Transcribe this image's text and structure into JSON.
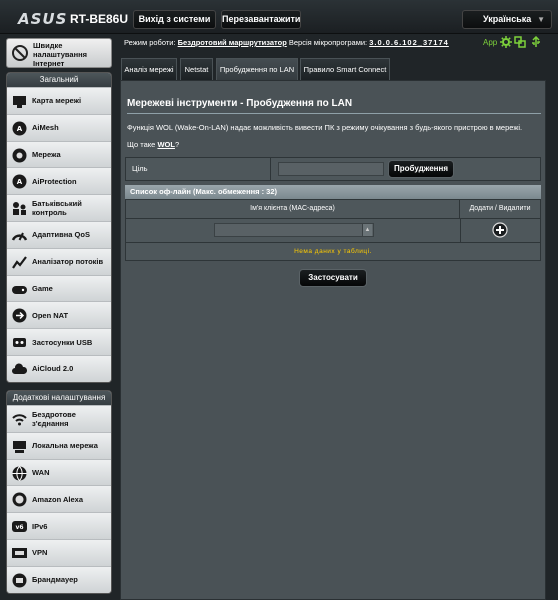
{
  "header": {
    "brand": "ASUS",
    "model": "RT-BE86U",
    "logout_label": "Вихід з системи",
    "reboot_label": "Перезавантажити",
    "language": "Українська"
  },
  "sidebar": {
    "internet_setup": "Швидке налаштування Інтернет",
    "general_title": "Загальний",
    "general_items": [
      {
        "label": "Карта мережі",
        "icon": "network-map-icon"
      },
      {
        "label": "AiMesh",
        "icon": "aimesh-icon"
      },
      {
        "label": "Мережа",
        "icon": "network-icon"
      },
      {
        "label": "AiProtection",
        "icon": "aiprotection-icon"
      },
      {
        "label": "Батьківський контроль",
        "icon": "parental-control-icon"
      },
      {
        "label": "Адаптивна QoS",
        "icon": "qos-icon"
      },
      {
        "label": "Аналізатор потоків",
        "icon": "traffic-analyzer-icon"
      },
      {
        "label": "Game",
        "icon": "game-icon"
      },
      {
        "label": "Open NAT",
        "icon": "open-nat-icon"
      },
      {
        "label": "Застосунки USB",
        "icon": "usb-icon"
      },
      {
        "label": "AiCloud 2.0",
        "icon": "aicloud-icon"
      }
    ],
    "advanced_title": "Додаткові налаштування",
    "advanced_items": [
      {
        "label": "Бездротове з'єднання",
        "icon": "wireless-icon"
      },
      {
        "label": "Локальна мережа",
        "icon": "lan-icon"
      },
      {
        "label": "WAN",
        "icon": "wan-icon"
      },
      {
        "label": "Amazon Alexa",
        "icon": "alexa-icon"
      },
      {
        "label": "IPv6",
        "icon": "ipv6-icon"
      },
      {
        "label": "VPN",
        "icon": "vpn-icon"
      },
      {
        "label": "Брандмауер",
        "icon": "firewall-icon"
      }
    ]
  },
  "status": {
    "mode_prefix": "Режим роботи:",
    "mode_value": "Бездротовий маршрутизатор",
    "fw_prefix": "Версія мікропрограми:",
    "fw_value": "3.0.0.6.102_37174",
    "app_label": "App"
  },
  "tabs": [
    {
      "label": "Аналіз мережі",
      "active": false
    },
    {
      "label": "Netstat",
      "active": false
    },
    {
      "label": "Пробудження по LAN",
      "active": true
    },
    {
      "label": "Правило Smart Connect",
      "active": false
    }
  ],
  "main": {
    "title": "Мережеві інструменти - Пробудження по LAN",
    "description": "Функція WOL (Wake-On-LAN) надає можливість вивести ПК з режиму очікування з будь-якого пристрою в мережі.",
    "wol_prefix": "Що таке",
    "wol_link": "WOL",
    "wol_suffix": "?",
    "target_label": "Ціль",
    "target_value": "",
    "wake_button": "Пробудження",
    "offline_list_title": "Список оф-лайн (Макс. обмеження : 32)",
    "col_client": "Ім'я клієнта (MAC-адреса)",
    "col_actions": "Додати / Видалити",
    "client_input_value": "",
    "empty_message": "Нема даних у таблиці.",
    "apply_button": "Застосувати"
  },
  "colors": {
    "accent_green": "#7dd23b",
    "empty_text": "#ffcc00"
  }
}
